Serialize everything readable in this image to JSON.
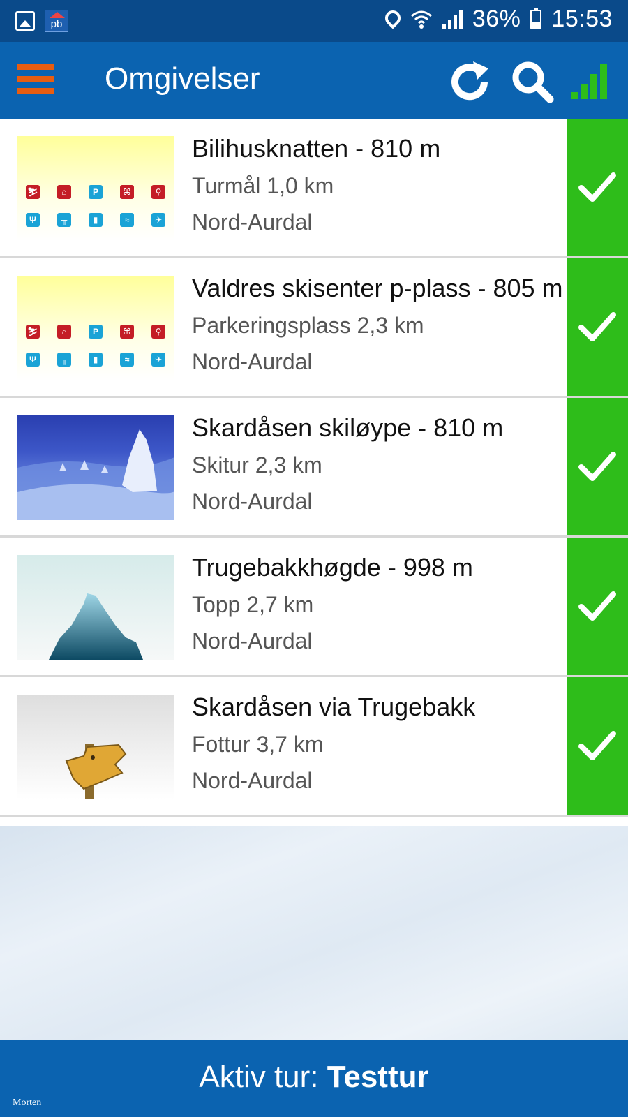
{
  "status_bar": {
    "battery_percent": "36%",
    "time": "15:53",
    "app_icon_label": "pb",
    "icons": [
      "image-icon",
      "pb-app-icon",
      "location-icon",
      "wifi-icon",
      "cell-signal-icon",
      "battery-icon"
    ]
  },
  "app_bar": {
    "title": "Omgivelser",
    "icons": [
      "hamburger-menu-icon",
      "refresh-icon",
      "search-icon",
      "signal-strength-icon"
    ],
    "accent_color": "#e85d10",
    "bar_color": "#0b63b0"
  },
  "items": [
    {
      "title": "Bilihusknatten - 810 m",
      "subtitle": "Turmål 1,0 km",
      "region": "Nord-Aurdal",
      "thumb": "facility-icons"
    },
    {
      "title": "Valdres skisenter p-plass - 805 m",
      "subtitle": "Parkeringsplass 2,3 km",
      "region": "Nord-Aurdal",
      "thumb": "facility-icons"
    },
    {
      "title": "Skardåsen skiløype - 810 m",
      "subtitle": "Skitur 2,3 km",
      "region": "Nord-Aurdal",
      "thumb": "snow-landscape"
    },
    {
      "title": "Trugebakkhøgde - 998 m",
      "subtitle": "Topp 2,7 km",
      "region": "Nord-Aurdal",
      "thumb": "mountain-peak"
    },
    {
      "title": "Skardåsen via Trugebakk",
      "subtitle": "Fottur 3,7 km",
      "region": "Nord-Aurdal",
      "thumb": "signpost"
    }
  ],
  "check_color": "#2ebd1a",
  "bottom_bar": {
    "prefix": "Aktiv tur: ",
    "trip_name": "Testtur",
    "credit": "Morten"
  }
}
